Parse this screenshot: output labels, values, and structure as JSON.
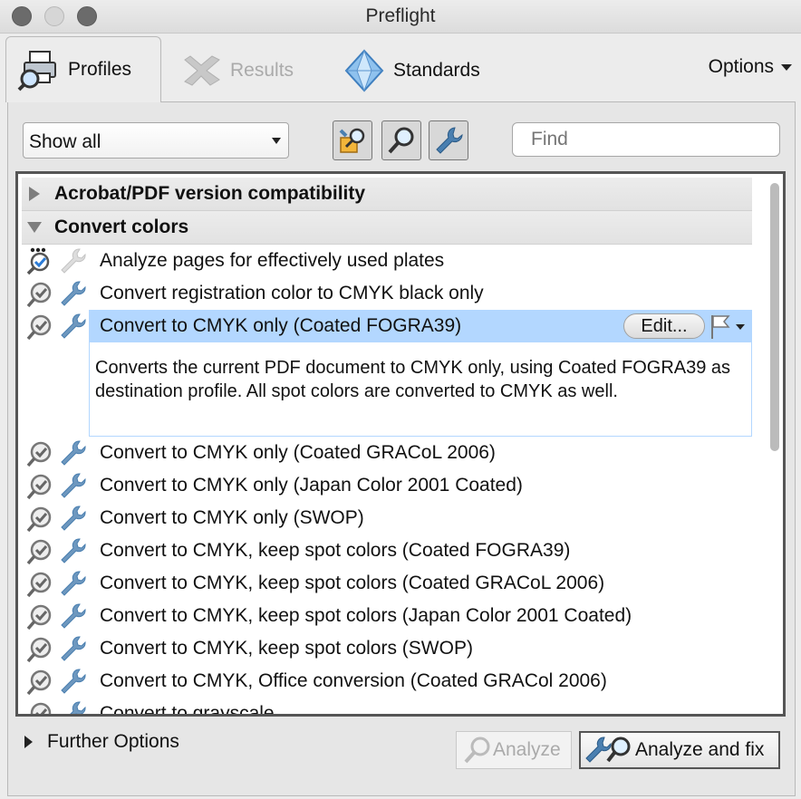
{
  "window": {
    "title": "Preflight"
  },
  "tabs": [
    {
      "label": "Profiles",
      "icon": "printer-magnifier-icon"
    },
    {
      "label": "Results",
      "icon": "results-x-icon"
    },
    {
      "label": "Standards",
      "icon": "diamond-icon"
    }
  ],
  "options": {
    "label": "Options"
  },
  "toolbar": {
    "select_value": "Show all",
    "find_placeholder": "Find",
    "buttons": [
      "fix-profile-icon",
      "analyze-magnifier-icon",
      "wrench-icon"
    ]
  },
  "groups": {
    "collapsed": {
      "label": "Acrobat/PDF version compatibility"
    },
    "expanded": {
      "label": "Convert colors"
    }
  },
  "items": [
    {
      "label": "Analyze pages for effectively used plates",
      "kind": "analyze"
    },
    {
      "label": "Convert registration color to CMYK black only",
      "kind": "fixup"
    }
  ],
  "selected_item": {
    "label": "Convert to CMYK only (Coated FOGRA39)",
    "edit_label": "Edit...",
    "description": "Converts the current PDF document to CMYK only, using Coated FOGRA39 as destination profile. All spot colors are converted to CMYK as well."
  },
  "items_after": [
    {
      "label": "Convert to CMYK only (Coated GRACoL 2006)"
    },
    {
      "label": "Convert to CMYK only (Japan Color 2001 Coated)"
    },
    {
      "label": "Convert to CMYK only (SWOP)"
    },
    {
      "label": "Convert to CMYK, keep spot colors (Coated FOGRA39)"
    },
    {
      "label": "Convert to CMYK, keep spot colors (Coated GRACoL 2006)"
    },
    {
      "label": "Convert to CMYK, keep spot colors (Japan Color 2001 Coated)"
    },
    {
      "label": "Convert to CMYK, keep spot colors (SWOP)"
    },
    {
      "label": "Convert to CMYK, Office conversion (Coated GRACol 2006)"
    },
    {
      "label": "Convert to grayscale"
    }
  ],
  "footer": {
    "further_options": "Further Options",
    "analyze_label": "Analyze",
    "analyze_fix_label": "Analyze and fix"
  },
  "colors": {
    "selection": "#b3d7ff",
    "wrench": "#4a7fb0"
  }
}
